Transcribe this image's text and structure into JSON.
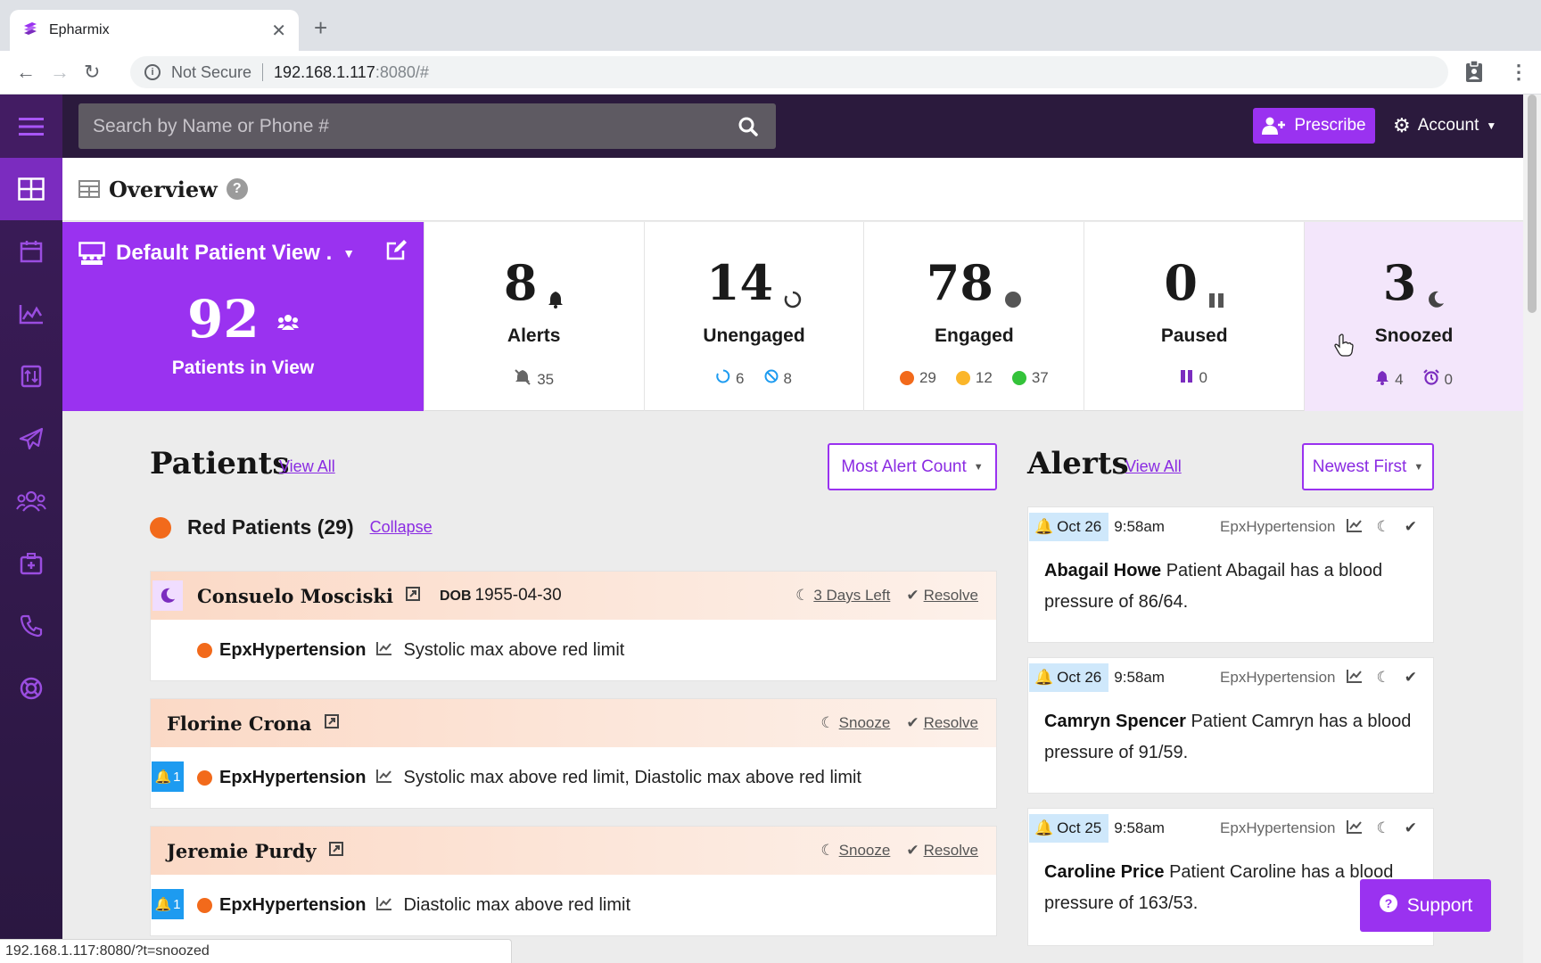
{
  "browser": {
    "tab_title": "Epharmix",
    "not_secure": "Not Secure",
    "url_host": "192.168.1.117",
    "url_path": ":8080/#",
    "status_url": "192.168.1.117:8080/?t=snoozed"
  },
  "header": {
    "search_placeholder": "Search by Name or Phone #",
    "prescribe_label": "Prescribe",
    "account_label": "Account"
  },
  "overview": {
    "title": "Overview"
  },
  "patient_view": {
    "title": "Default Patient View .",
    "count": "92",
    "label": "Patients in View"
  },
  "stats": {
    "alerts": {
      "value": "8",
      "label": "Alerts",
      "muted": "35"
    },
    "unengaged": {
      "value": "14",
      "label": "Unengaged",
      "a": "6",
      "b": "8"
    },
    "engaged": {
      "value": "78",
      "label": "Engaged",
      "red": "29",
      "yellow": "12",
      "green": "37"
    },
    "paused": {
      "value": "0",
      "label": "Paused",
      "sub": "0"
    },
    "snoozed": {
      "value": "3",
      "label": "Snoozed",
      "bell": "4",
      "alarm": "0"
    }
  },
  "patients": {
    "title": "Patients",
    "view_all": "View All",
    "sort": "Most Alert Count",
    "group_title": "Red Patients (29)",
    "collapse": "Collapse",
    "list": [
      {
        "name": "Consuelo Mosciski",
        "dob_label": "DOB",
        "dob": "1955-04-30",
        "snooze": "3 Days Left",
        "resolve": "Resolve",
        "program": "EpxHypertension",
        "message": "Systolic max above red limit"
      },
      {
        "name": "Florine Crona",
        "snooze": "Snooze",
        "resolve": "Resolve",
        "badge": "1",
        "program": "EpxHypertension",
        "message": "Systolic max above red limit, Diastolic max above red limit"
      },
      {
        "name": "Jeremie Purdy",
        "snooze": "Snooze",
        "resolve": "Resolve",
        "badge": "1",
        "program": "EpxHypertension",
        "message": "Diastolic max above red limit"
      }
    ]
  },
  "alerts": {
    "title": "Alerts",
    "view_all": "View All",
    "sort": "Newest First",
    "list": [
      {
        "date": "Oct 26",
        "time": "9:58am",
        "program": "EpxHypertension",
        "name": "Abagail Howe",
        "message": "Patient Abagail has a blood pressure of 86/64."
      },
      {
        "date": "Oct 26",
        "time": "9:58am",
        "program": "EpxHypertension",
        "name": "Camryn Spencer",
        "message": "Patient Camryn has a blood pressure of 91/59."
      },
      {
        "date": "Oct 25",
        "time": "9:58am",
        "program": "EpxHypertension",
        "name": "Caroline Price",
        "message": "Patient Caroline has a blood pressure of 163/53."
      }
    ]
  },
  "support_label": "Support",
  "colors": {
    "brand": "#9a32f0",
    "nav": "#2b1a3d",
    "red": "#f26a1b",
    "yellow": "#fbb62a",
    "green": "#34c33a",
    "blue": "#1d9bf0"
  }
}
